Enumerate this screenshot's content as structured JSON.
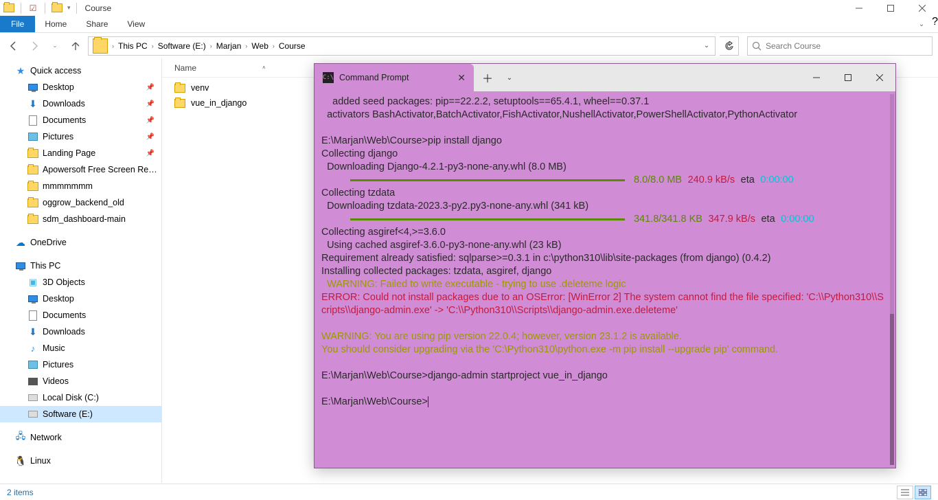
{
  "window": {
    "title": "Course",
    "minimize": "—",
    "maximize": "☐",
    "close": "✕"
  },
  "ribbon": {
    "file": "File",
    "home": "Home",
    "share": "Share",
    "view": "View"
  },
  "breadcrumb": {
    "root": "This PC",
    "drive": "Software (E:)",
    "folder1": "Marjan",
    "folder2": "Web",
    "folder3": "Course"
  },
  "search": {
    "placeholder": "Search Course"
  },
  "sidebar": {
    "quick_access": "Quick access",
    "desktop": "Desktop",
    "downloads": "Downloads",
    "documents": "Documents",
    "pictures": "Pictures",
    "landing": "Landing Page",
    "apower": "Apowersoft Free Screen Recorder",
    "mmm": "mmmmmmm",
    "oggrow": "oggrow_backend_old",
    "sdm": "sdm_dashboard-main",
    "onedrive": "OneDrive",
    "thispc": "This PC",
    "objects3d": "3D Objects",
    "desktop2": "Desktop",
    "documents2": "Documents",
    "downloads2": "Downloads",
    "music": "Music",
    "pictures2": "Pictures",
    "videos": "Videos",
    "localdisk": "Local Disk (C:)",
    "software": "Software (E:)",
    "network": "Network",
    "linux": "Linux"
  },
  "colheader": {
    "name": "Name"
  },
  "files": {
    "venv": "venv",
    "vue": "vue_in_django"
  },
  "terminal": {
    "tab_title": "Command Prompt",
    "l1": "    added seed packages: pip==22.2.2, setuptools==65.4.1, wheel==0.37.1",
    "l2": "  activators BashActivator,BatchActivator,FishActivator,NushellActivator,PowerShellActivator,PythonActivator",
    "p1": "E:\\Marjan\\Web\\Course>",
    "cmd1": "pip install django",
    "coll1": "Collecting django",
    "dl1": "  Downloading Django-4.2.1-py3-none-any.whl (8.0 MB)",
    "prog1_done": "8.0/8.0 MB",
    "prog1_speed": "240.9 kB/s",
    "prog1_eta_label": "eta",
    "prog1_eta": "0:00:00",
    "coll2": "Collecting tzdata",
    "dl2": "  Downloading tzdata-2023.3-py2.py3-none-any.whl (341 kB)",
    "prog2_done": "341.8/341.8 KB",
    "prog2_speed": "347.9 kB/s",
    "prog2_eta": "0:00:00",
    "coll3": "Collecting asgiref<4,>=3.6.0",
    "dl3": "  Using cached asgiref-3.6.0-py3-none-any.whl (23 kB)",
    "req": "Requirement already satisfied: sqlparse>=0.3.1 in c:\\python310\\lib\\site-packages (from django) (0.4.2)",
    "inst": "Installing collected packages: tzdata, asgiref, django",
    "warn1": "  WARNING: Failed to write executable - trying to use .deleteme logic",
    "err": "ERROR: Could not install packages due to an OSError: [WinError 2] The system cannot find the file specified: 'C:\\\\Python310\\\\Scripts\\\\django-admin.exe' -> 'C:\\\\Python310\\\\Scripts\\\\django-admin.exe.deleteme'",
    "warn2a": "WARNING: You are using pip version 22.0.4; however, version 23.1.2 is available.",
    "warn2b": "You should consider upgrading via the 'C:\\Python310\\python.exe -m pip install --upgrade pip' command.",
    "cmd2": "django-admin startproject vue_in_django",
    "p2": "E:\\Marjan\\Web\\Course>"
  },
  "statusbar": {
    "items": "2 items"
  }
}
